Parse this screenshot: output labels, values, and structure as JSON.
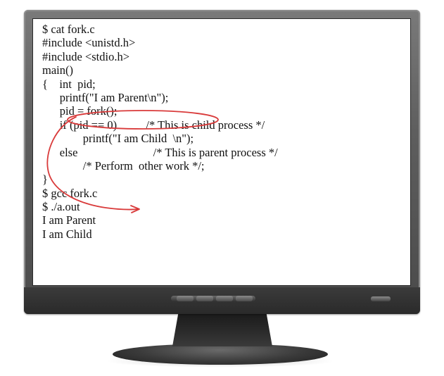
{
  "screen": {
    "code_lines": [
      "$ cat fork.c",
      "#include <unistd.h>",
      "#include <stdio.h>",
      "main()",
      "{    int  pid;",
      "      printf(\"I am Parent\\n\");",
      "      pid = fork();",
      "      if (pid == 0)          /* This is child process */",
      "              printf(\"I am Child  \\n\");",
      "      else                          /* This is parent process */",
      "              /* Perform  other work */;",
      "}",
      "$ gcc fork.c",
      "$ ./a.out",
      "I am Parent",
      "I am Child"
    ]
  },
  "annotation": {
    "color": "#d93a3a"
  }
}
